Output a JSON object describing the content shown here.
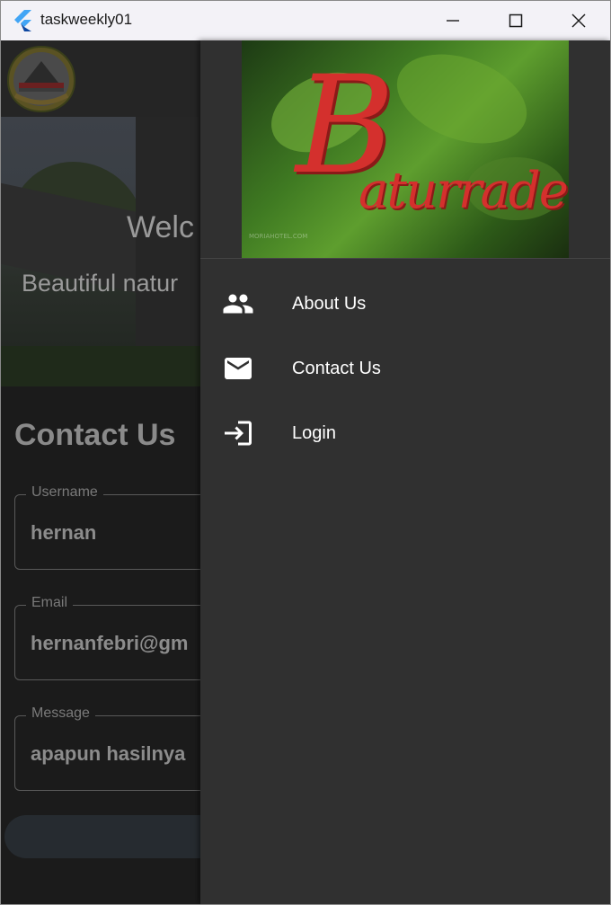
{
  "window": {
    "title": "taskweekly01"
  },
  "page": {
    "hero_title": "Welc",
    "hero_subtitle": "Beautiful natur",
    "section_title": "Contact Us",
    "form": {
      "username": {
        "label": "Username",
        "value": "hernan"
      },
      "email": {
        "label": "Email",
        "value": "hernanfebri@gm"
      },
      "message": {
        "label": "Message",
        "value": "apapun hasilnya"
      }
    }
  },
  "drawer": {
    "header_image": {
      "alt": "Baturraden sign"
    },
    "menu": [
      {
        "label": "About Us",
        "icon": "people-icon"
      },
      {
        "label": "Contact Us",
        "icon": "mail-icon"
      },
      {
        "label": "Login",
        "icon": "login-icon"
      }
    ]
  },
  "colors": {
    "drawer_bg": "#303030",
    "sign_red": "#d4302d",
    "titlebar_bg": "#f3f2f7"
  }
}
